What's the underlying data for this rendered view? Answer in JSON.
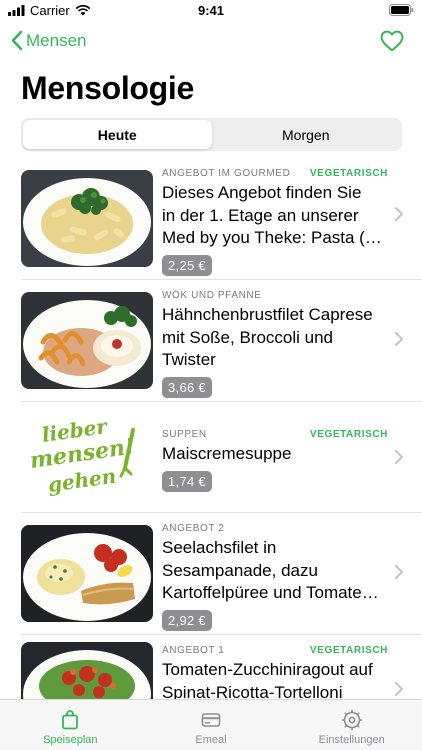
{
  "status": {
    "carrier": "Carrier",
    "time": "9:41"
  },
  "nav": {
    "back_label": "Mensen",
    "favorite_icon": "heart-outline-icon"
  },
  "page": {
    "title": "Mensologie"
  },
  "segments": [
    {
      "label": "Heute",
      "selected": true
    },
    {
      "label": "Morgen",
      "selected": false
    }
  ],
  "meals": [
    {
      "category": "ANGEBOT IM GOURMED",
      "tag": "VEGETARISCH",
      "title_lines": [
        "Dieses Angebot finden Sie",
        "in der 1. Etage an unserer",
        "Med by you Theke: Pasta (…"
      ],
      "price": "2,25 €"
    },
    {
      "category": "WOK UND PFANNE",
      "tag": "",
      "title_lines": [
        "Hähnchenbrustfilet Caprese",
        "mit Soße, Broccoli und",
        "Twister"
      ],
      "price": "3,66 €"
    },
    {
      "category": "SUPPEN",
      "tag": "VEGETARISCH",
      "title_lines": [
        "Maiscremesuppe"
      ],
      "price": "1,74 €",
      "logo_text": [
        "lieber",
        "mensen!",
        "gehen"
      ]
    },
    {
      "category": "ANGEBOT 2",
      "tag": "",
      "title_lines": [
        "Seelachsfilet in",
        "Sesampanade, dazu",
        "Kartoffelpüree und Tomate…"
      ],
      "price": "2,92 €"
    },
    {
      "category": "ANGEBOT 1",
      "tag": "VEGETARISCH",
      "title_lines": [
        "Tomaten-Zucchiniragout auf",
        "Spinat-Ricotta-Tortelloni"
      ],
      "price": ""
    }
  ],
  "tabs": [
    {
      "label": "Speiseplan",
      "icon": "bag-icon",
      "active": true
    },
    {
      "label": "Emeal",
      "icon": "card-icon",
      "active": false
    },
    {
      "label": "Einstellungen",
      "icon": "gear-icon",
      "active": false
    }
  ],
  "colors": {
    "accent": "#34b857",
    "price_badge": "#8e8e93",
    "secondary_text": "#7b7b80"
  }
}
